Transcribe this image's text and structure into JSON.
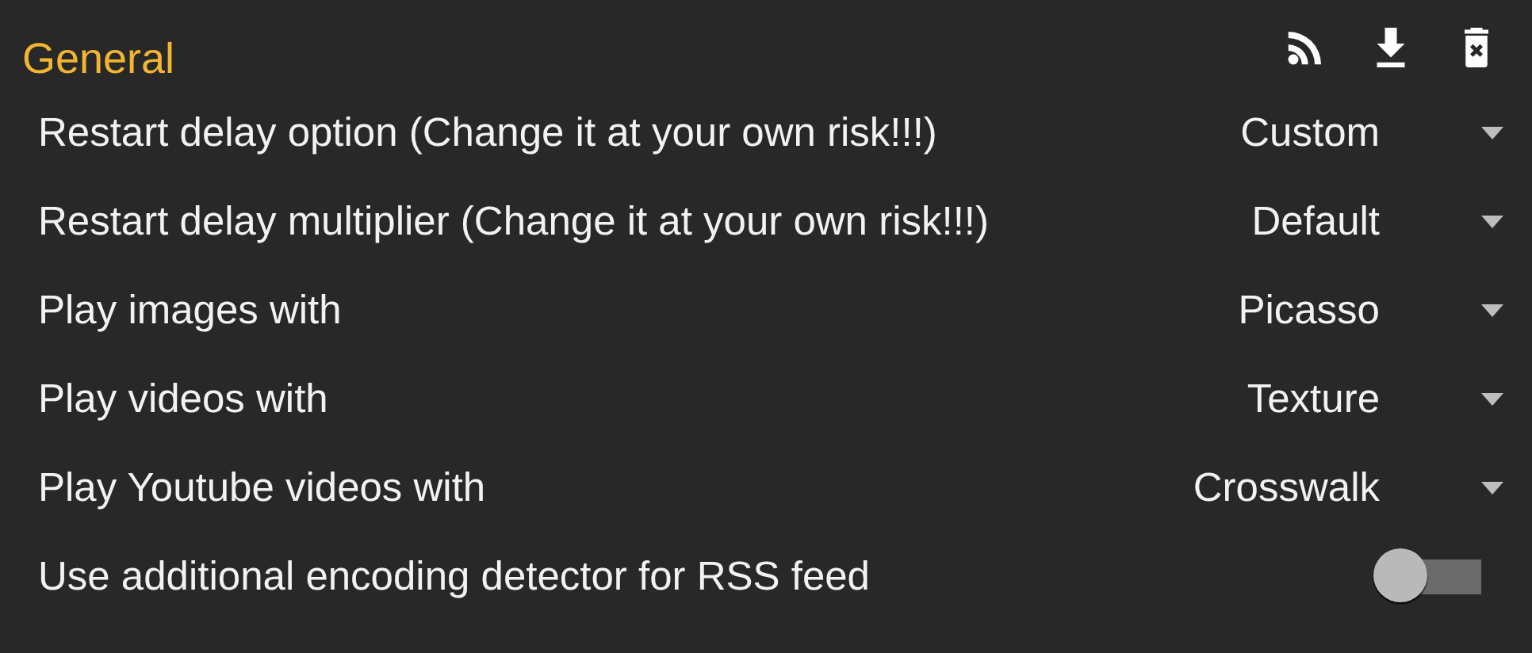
{
  "section": {
    "title": "General"
  },
  "toolbar": [
    {
      "kind": "rss"
    },
    {
      "kind": "download"
    },
    {
      "kind": "delete"
    }
  ],
  "settings": [
    {
      "kind": "dropdown",
      "label": "Restart delay option (Change it at your own risk!!!)",
      "value": "Custom"
    },
    {
      "kind": "dropdown",
      "label": "Restart delay multiplier (Change it at your own risk!!!)",
      "value": "Default"
    },
    {
      "kind": "dropdown",
      "label": "Play images with",
      "value": "Picasso"
    },
    {
      "kind": "dropdown",
      "label": "Play videos with",
      "value": "Texture"
    },
    {
      "kind": "dropdown",
      "label": "Play Youtube videos with",
      "value": "Crosswalk"
    },
    {
      "kind": "switch",
      "label": "Use additional encoding detector for RSS feed",
      "on": false
    }
  ]
}
